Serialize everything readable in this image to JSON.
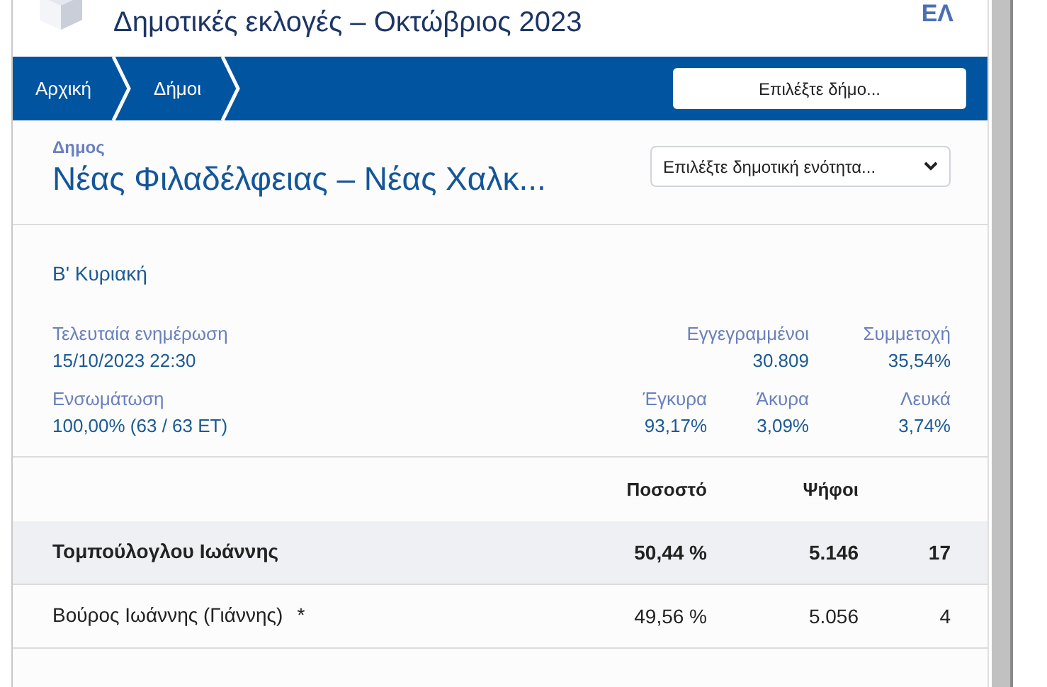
{
  "header": {
    "title": "Δημοτικές εκλογές – Οκτώβριος 2023",
    "language": "ΕΛ"
  },
  "nav": {
    "breadcrumbs": [
      {
        "label": "Αρχική"
      },
      {
        "label": "Δήμοι"
      }
    ],
    "municipality_select": {
      "placeholder": "Επιλέξτε δήμο..."
    }
  },
  "municipality": {
    "label": "Δημος",
    "name": "Νέας Φιλαδέλφειας – Νέας Χαλκ...",
    "unit_select": {
      "placeholder": "Επιλέξτε δημοτική ενότητα..."
    }
  },
  "round": "Β' Κυριακή",
  "stats": {
    "last_update": {
      "label": "Τελευταία ενημέρωση",
      "value": "15/10/2023 22:30"
    },
    "registered": {
      "label": "Εγγεγραμμένοι",
      "value": "30.809"
    },
    "turnout": {
      "label": "Συμμετοχή",
      "value": "35,54%"
    },
    "counted": {
      "label": "Ενσωμάτωση",
      "value": "100,00% (63 / 63 ΕΤ)"
    },
    "valid": {
      "label": "Έγκυρα",
      "value": "93,17%"
    },
    "invalid": {
      "label": "Άκυρα",
      "value": "3,09%"
    },
    "blank": {
      "label": "Λευκά",
      "value": "3,74%"
    }
  },
  "table": {
    "columns": [
      "Ποσοστό",
      "Ψήφοι"
    ],
    "rows": [
      {
        "name": "Τομπούλογλου Ιωάννης",
        "percent": "50,44 %",
        "votes": "5.146",
        "seats": "17",
        "leading": true
      },
      {
        "name": "Βούρος Ιωάννης (Γιάννης)",
        "note": "*",
        "percent": "49,56 %",
        "votes": "5.056",
        "seats": "4",
        "leading": false
      }
    ]
  }
}
